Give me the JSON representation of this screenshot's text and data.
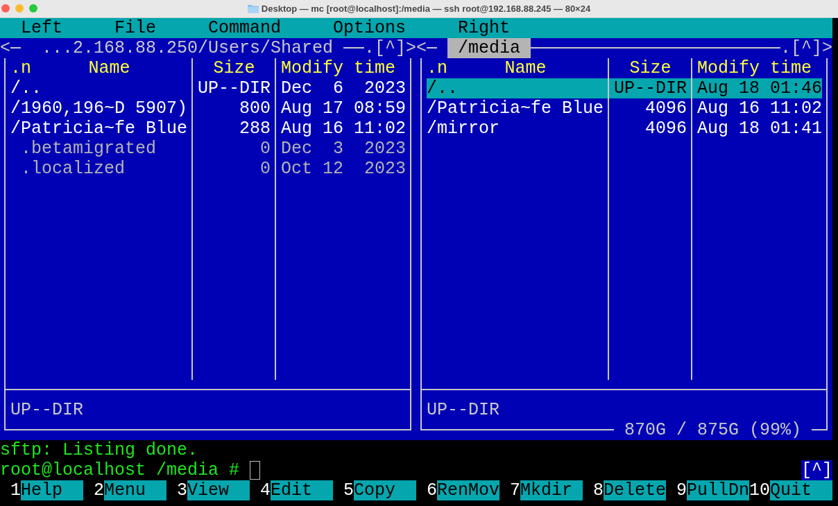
{
  "window": {
    "title": "Desktop — mc [root@localhost]:/media — ssh root@192.168.88.245 — 80×24"
  },
  "menu": [
    "Left",
    "File",
    "Command",
    "Options",
    "Right"
  ],
  "panels": [
    {
      "active": false,
      "back": "<",
      "path": "...2.168.88.250/Users/Shared",
      "markers": ".[^]>",
      "columns": [
        ".n",
        "Name",
        "Size",
        "Modify time"
      ],
      "files": [
        {
          "name": "/..",
          "size": "UP--DIR",
          "time": "Dec  6  2023",
          "kind": "directory",
          "selected": false
        },
        {
          "name": "/1960,196~D 5907)",
          "size": "800",
          "time": "Aug 17 08:59",
          "kind": "directory",
          "selected": false
        },
        {
          "name": "/Patricia~fe Blue",
          "size": "288",
          "time": "Aug 16 11:02",
          "kind": "directory",
          "selected": false
        },
        {
          "name": " .betamigrated",
          "size": "0",
          "time": "Dec  3  2023",
          "kind": "hidden",
          "selected": false
        },
        {
          "name": " .localized",
          "size": "0",
          "time": "Oct 12  2023",
          "kind": "hidden",
          "selected": false
        }
      ],
      "status": "UP--DIR"
    },
    {
      "active": true,
      "back": "<",
      "path": "/media",
      "markers": ".[^]>",
      "columns": [
        ".n",
        "Name",
        "Size",
        "Modify time"
      ],
      "files": [
        {
          "name": "/..",
          "size": "UP--DIR",
          "time": "Aug 18 01:46",
          "kind": "directory",
          "selected": true
        },
        {
          "name": "/Patricia~fe Blue",
          "size": "4096",
          "time": "Aug 16 11:02",
          "kind": "directory",
          "selected": false
        },
        {
          "name": "/mirror",
          "size": "4096",
          "time": "Aug 18 01:41",
          "kind": "directory",
          "selected": false
        }
      ],
      "status": "UP--DIR",
      "disk_usage": "870G / 875G (99%)"
    }
  ],
  "console": {
    "output": "sftp: Listing done.",
    "prompt": "root@localhost /media #",
    "history_button": "[^]"
  },
  "keybar": [
    {
      "key": "1",
      "label": "Help"
    },
    {
      "key": "2",
      "label": "Menu"
    },
    {
      "key": "3",
      "label": "View"
    },
    {
      "key": "4",
      "label": "Edit"
    },
    {
      "key": "5",
      "label": "Copy"
    },
    {
      "key": "6",
      "label": "RenMov"
    },
    {
      "key": "7",
      "label": "Mkdir"
    },
    {
      "key": "8",
      "label": "Delete"
    },
    {
      "key": "9",
      "label": "PullDn"
    },
    {
      "key": "10",
      "label": "Quit"
    }
  ]
}
